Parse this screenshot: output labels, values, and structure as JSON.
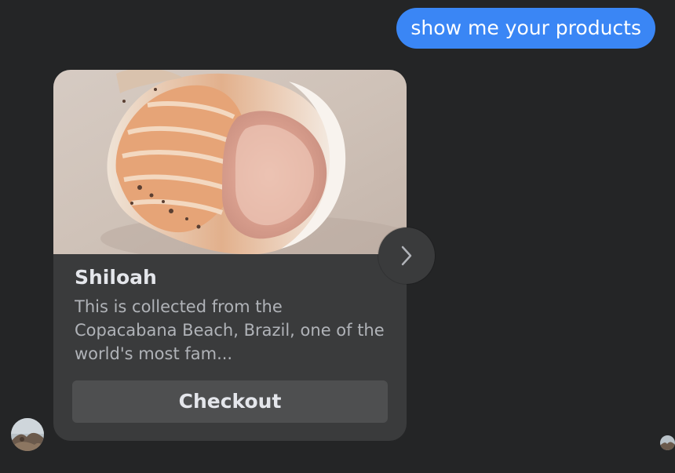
{
  "user_message": {
    "text": "show me your products",
    "bubble_color": "#3a86f5"
  },
  "product_card": {
    "image_icon": "seashell-photo",
    "title": "Shiloah",
    "description": "This is collected from the Copacabana Beach, Brazil, one of the world's most fam...",
    "checkout_label": "Checkout"
  },
  "carousel": {
    "next_icon": "chevron-right-icon"
  },
  "avatars": {
    "bot_avatar_icon": "beach-rocks-avatar",
    "seen_avatar_icon": "beach-rocks-avatar-small"
  },
  "theme": {
    "background": "#242526",
    "card_background": "#3a3b3c",
    "button_background": "#4e4f50",
    "title_color": "#e4e6eb",
    "description_color": "#b0b3b8"
  }
}
